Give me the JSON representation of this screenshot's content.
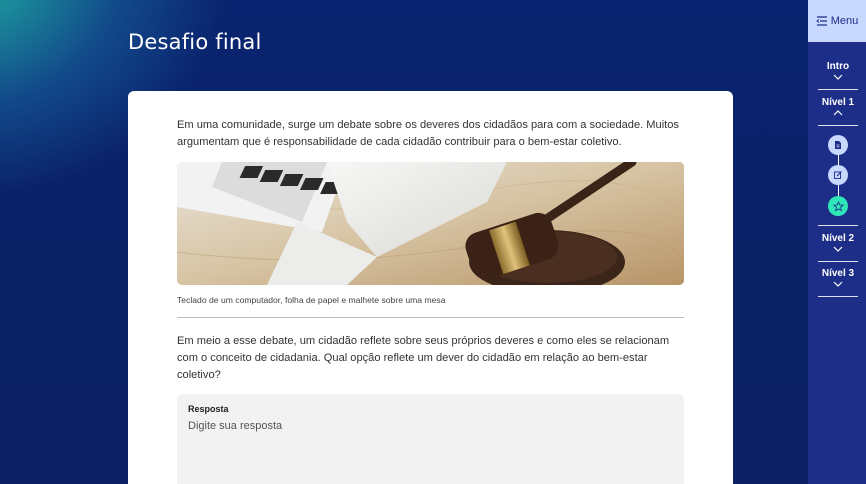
{
  "page": {
    "title": "Desafio final"
  },
  "content": {
    "intro": "Em uma comunidade, surge um debate sobre os deveres dos cidadãos para com a sociedade. Muitos argumentam que é responsabilidade de cada cidadão contribuir para o bem-estar coletivo.",
    "image_caption": "Teclado de um computador, folha de papel e malhete sobre uma mesa",
    "question": "Em meio a esse debate, um cidadão reflete sobre seus próprios deveres e como eles se relacionam com o conceito de cidadania. Qual opção reflete um dever do cidadão em relação ao bem-estar coletivo?",
    "answer_label": "Resposta",
    "answer_placeholder": "Digite sua resposta"
  },
  "sidebar": {
    "menu_label": "Menu",
    "menu_icon": "menu-lines-icon",
    "sections": [
      {
        "label": "Intro",
        "state": "collapsed"
      },
      {
        "label": "Nível 1",
        "state": "expanded"
      },
      {
        "label": "Nível 2",
        "state": "collapsed"
      },
      {
        "label": "Nível 3",
        "state": "collapsed"
      }
    ],
    "steps": [
      {
        "icon": "document-icon",
        "active": false
      },
      {
        "icon": "edit-icon",
        "active": false
      },
      {
        "icon": "star-icon",
        "active": true
      }
    ]
  },
  "colors": {
    "sidebar_bg": "#1c2e88",
    "menu_bg": "#c9d8ff",
    "step_bg": "#c9d8ff",
    "step_active_bg": "#2ee6b8",
    "background_dark": "#0b2266",
    "background_teal": "#1fa9a3"
  }
}
